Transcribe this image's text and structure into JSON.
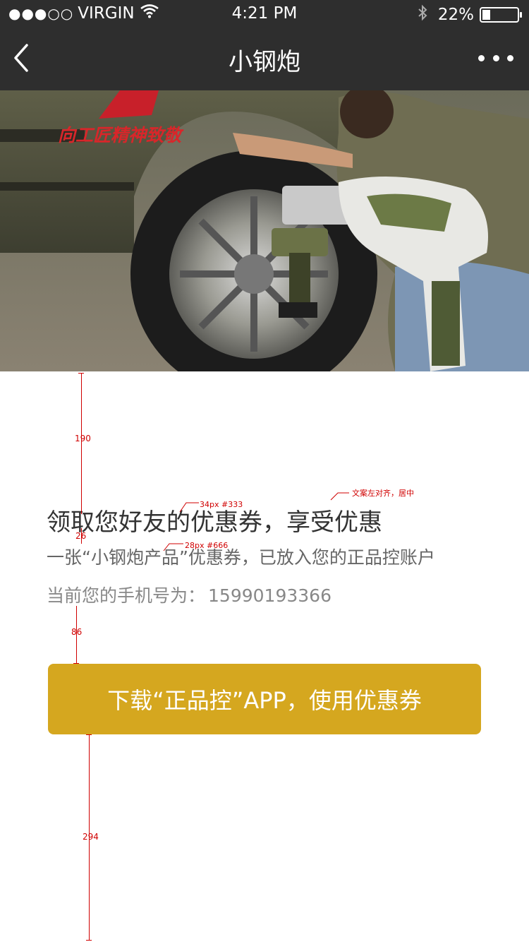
{
  "status_bar": {
    "carrier": "VIRGIN",
    "time": "4:21 PM",
    "battery_percent": "22%",
    "battery_level": 0.22
  },
  "nav": {
    "title": "小钢炮",
    "back_icon": "chevron-left-icon",
    "more_icon": "more-dots-icon"
  },
  "hero": {
    "slogan": "向工匠精神致敬"
  },
  "content": {
    "title": "领取您好友的优惠券，享受优惠",
    "description": "一张“小钢炮产品”优惠券，已放入您的正品控账户",
    "phone_label": "当前您的手机号为：",
    "phone_number": "15990193366"
  },
  "action": {
    "button_label": "下载“正品控”APP，使用优惠券"
  },
  "annotations": {
    "spacing_190": "190",
    "spacing_26": "26",
    "spacing_86": "86",
    "spacing_294": "294",
    "title_spec": "34px  #333",
    "desc_spec": "28px  #666",
    "align_note": "文案左对齐，居中"
  },
  "colors": {
    "topbar": "#2e2e2e",
    "button": "#d5a71f",
    "title_text": "#333333",
    "desc_text": "#666666",
    "annotation": "#d00000"
  }
}
